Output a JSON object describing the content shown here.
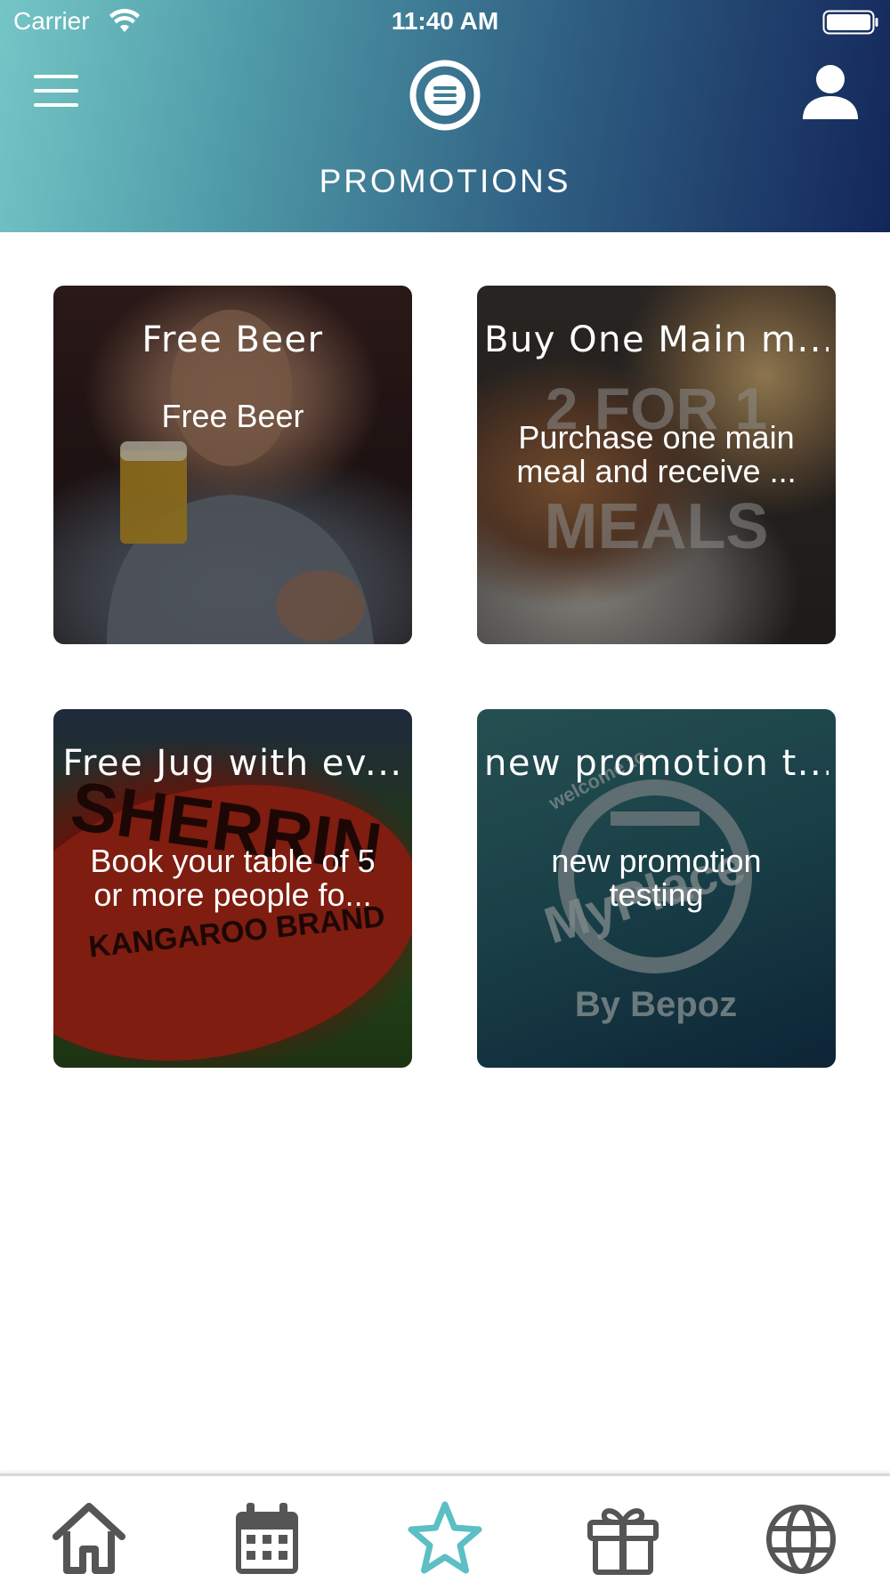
{
  "status_bar": {
    "carrier": "Carrier",
    "time": "11:40 AM"
  },
  "header": {
    "title": "PROMOTIONS",
    "menu_icon": "hamburger-menu-icon",
    "logo_icon": "circle-list-logo-icon",
    "profile_icon": "user-profile-icon"
  },
  "promotions": [
    {
      "title": "Free Beer",
      "description": "Free Beer"
    },
    {
      "title": "Buy One Main m...",
      "description_lines": [
        "Purchase one main",
        "meal and receive ..."
      ]
    },
    {
      "title": "Free Jug with ev...",
      "description_lines": [
        "Book your table of 5",
        "or more people fo..."
      ]
    },
    {
      "title": "new promotion t...",
      "description_lines": [
        "new promotion",
        "testing"
      ]
    }
  ],
  "image_text": {
    "meals_line1": "2 FOR 1",
    "meals_line2": "MEALS",
    "ball_line1": "SHERRIN",
    "ball_line2": "KANGAROO BRAND",
    "logo_line1": "welcome to",
    "logo_line2": "MyPlace",
    "logo_line3": "By Bepoz"
  },
  "tab_bar": {
    "tabs": [
      {
        "icon": "home-icon",
        "active": false
      },
      {
        "icon": "calendar-icon",
        "active": false
      },
      {
        "icon": "star-icon",
        "active": true
      },
      {
        "icon": "gift-icon",
        "active": false
      },
      {
        "icon": "globe-icon",
        "active": false
      }
    ],
    "active_color": "#5bbfc4",
    "inactive_color": "#555555"
  },
  "colors": {
    "header_gradient_start": "#74c6c6",
    "header_gradient_end": "#13265a"
  }
}
